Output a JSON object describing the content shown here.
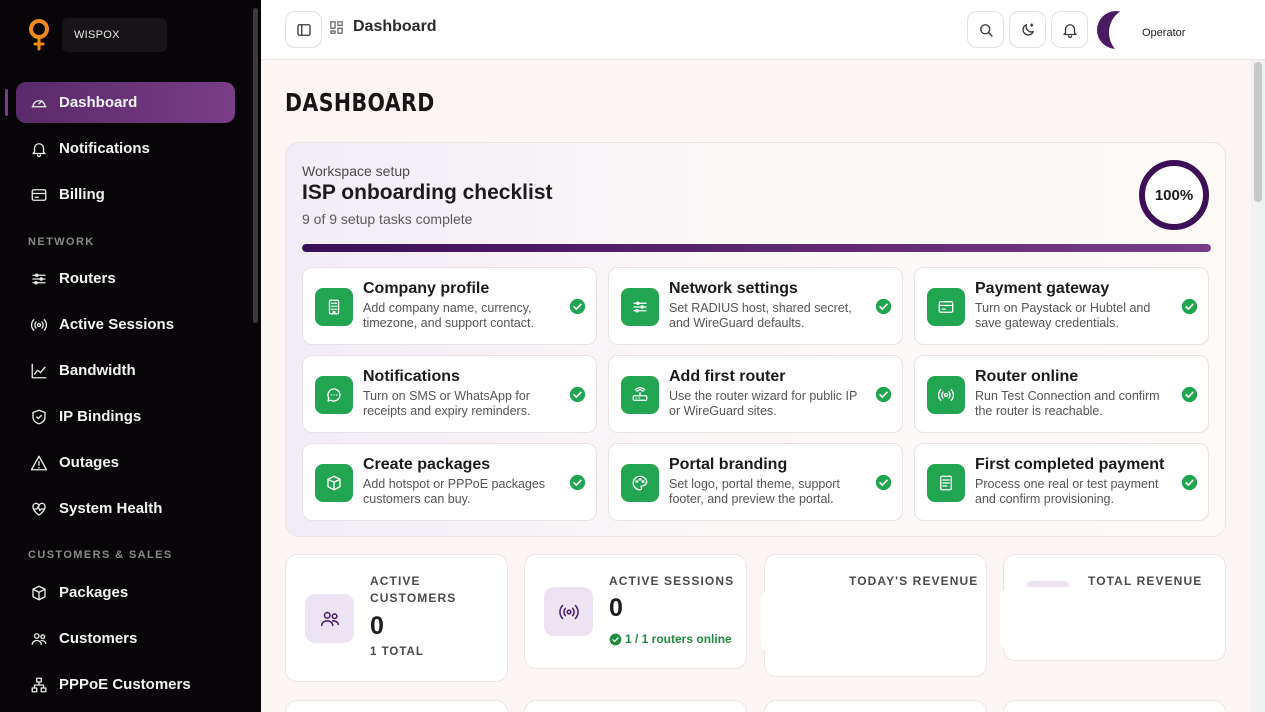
{
  "brand": {
    "name": "WISPOX",
    "accent": "#f08a1c"
  },
  "sidebar": {
    "items": [
      {
        "label": "Dashboard",
        "icon": "gauge-icon",
        "active": true
      },
      {
        "label": "Notifications",
        "icon": "bell-icon"
      },
      {
        "label": "Billing",
        "icon": "card-icon"
      },
      {
        "label": "Routers",
        "icon": "router-icon"
      },
      {
        "label": "Active Sessions",
        "icon": "broadcast-icon"
      },
      {
        "label": "Bandwidth",
        "icon": "chart-line-icon"
      },
      {
        "label": "IP Bindings",
        "icon": "shield-icon"
      },
      {
        "label": "Outages",
        "icon": "warning-icon"
      },
      {
        "label": "System Health",
        "icon": "heart-pulse-icon"
      },
      {
        "label": "Packages",
        "icon": "box-icon"
      },
      {
        "label": "Customers",
        "icon": "users-icon"
      },
      {
        "label": "PPPoE Customers",
        "icon": "network-icon"
      }
    ],
    "sections": [
      "NETWORK",
      "CUSTOMERS & SALES"
    ]
  },
  "topbar": {
    "breadcrumb": "Dashboard",
    "user_role": "Operator"
  },
  "page": {
    "title": "DASHBOARD"
  },
  "checklist": {
    "eyebrow": "Workspace setup",
    "title": "ISP onboarding checklist",
    "subtitle": "9 of 9 setup tasks complete",
    "percent_label": "100%",
    "progress": 1.0,
    "tasks": [
      {
        "title": "Company profile",
        "desc": "Add company name, currency, timezone, and support contact.",
        "icon": "building-icon",
        "done": true
      },
      {
        "title": "Network settings",
        "desc": "Set RADIUS host, shared secret, and WireGuard defaults.",
        "icon": "sliders-icon",
        "done": true
      },
      {
        "title": "Payment gateway",
        "desc": "Turn on Paystack or Hubtel and save gateway credentials.",
        "icon": "card-icon",
        "done": true
      },
      {
        "title": "Notifications",
        "desc": "Turn on SMS or WhatsApp for receipts and expiry reminders.",
        "icon": "chat-icon",
        "done": true
      },
      {
        "title": "Add first router",
        "desc": "Use the router wizard for public IP or WireGuard sites.",
        "icon": "router-icon",
        "done": true
      },
      {
        "title": "Router online",
        "desc": "Run Test Connection and confirm the router is reachable.",
        "icon": "broadcast-icon",
        "done": true
      },
      {
        "title": "Create packages",
        "desc": "Add hotspot or PPPoE packages customers can buy.",
        "icon": "box-icon",
        "done": true
      },
      {
        "title": "Portal branding",
        "desc": "Set logo, portal theme, support footer, and preview the portal.",
        "icon": "palette-icon",
        "done": true
      },
      {
        "title": "First completed payment",
        "desc": "Process one real or test payment and confirm provisioning.",
        "icon": "receipt-icon",
        "done": true
      }
    ]
  },
  "stats": {
    "active_customers": {
      "label": "ACTIVE CUSTOMERS",
      "value": "0",
      "note": "1 TOTAL"
    },
    "active_sessions": {
      "label": "ACTIVE SESSIONS",
      "value": "0",
      "note": "1 / 1 routers online"
    },
    "todays_revenue": {
      "label": "TODAY'S REVENUE"
    },
    "total_revenue": {
      "label": "TOTAL REVENUE"
    }
  },
  "colors": {
    "primary": "#4b1a63",
    "success": "#22a550",
    "sidebar_bg": "#070507"
  }
}
